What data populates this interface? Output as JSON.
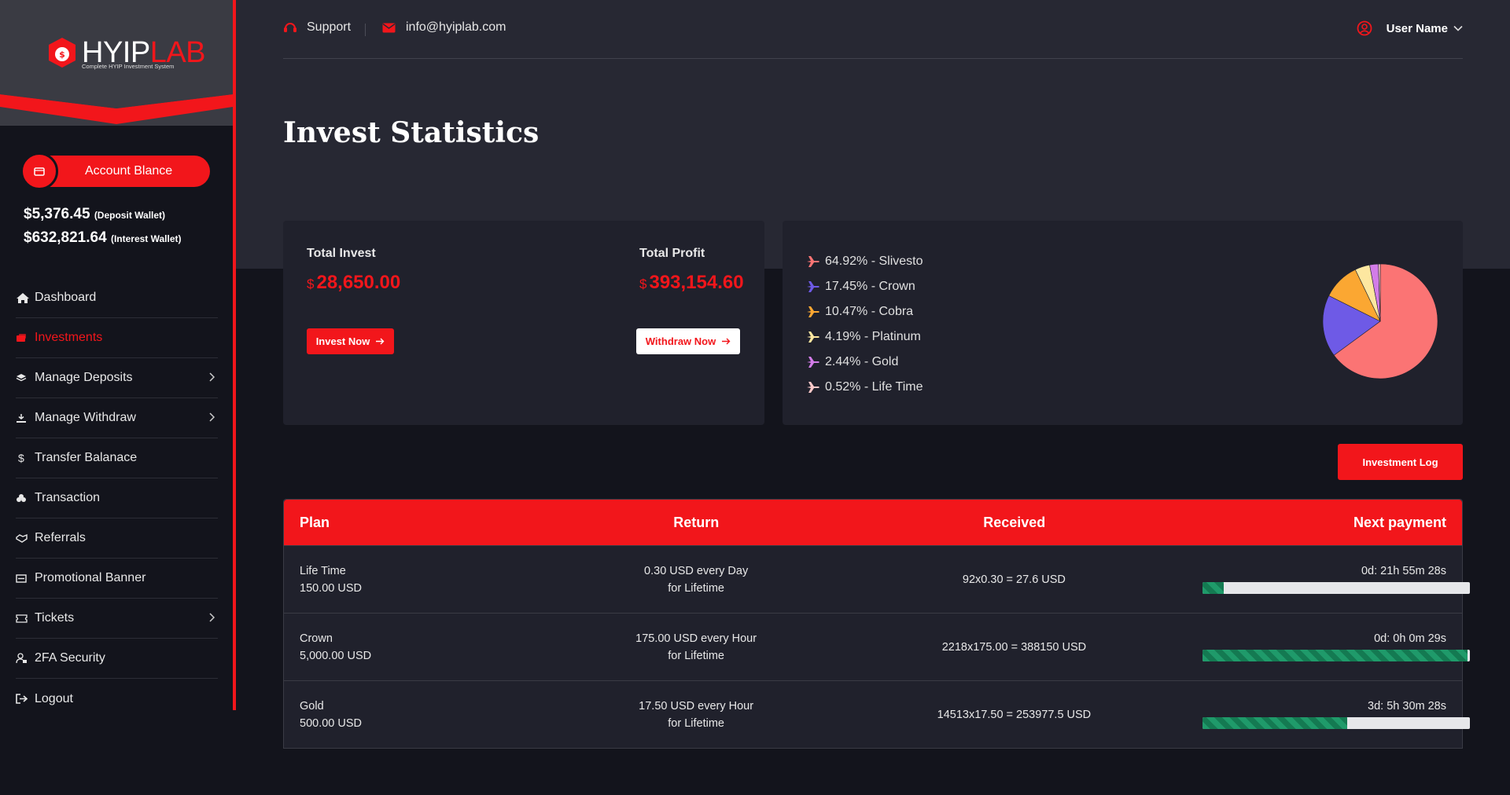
{
  "brand": {
    "name_a": "HYIP",
    "name_b": "LAB",
    "tagline": "Complete HYIP Investment System"
  },
  "colors": {
    "accent": "#f2161b",
    "bg": "#13141c",
    "card": "#20212c",
    "header_bg": "#272833"
  },
  "sidebar": {
    "balance_button": "Account Blance",
    "deposit_wallet": {
      "amount": "$5,376.45",
      "label": "(Deposit Wallet)"
    },
    "interest_wallet": {
      "amount": "$632,821.64",
      "label": "(Interest Wallet)"
    },
    "items": [
      {
        "label": "Dashboard",
        "icon": "home-icon"
      },
      {
        "label": "Investments",
        "icon": "investment-icon",
        "active": true
      },
      {
        "label": "Manage Deposits",
        "icon": "layers-icon",
        "submenu": true
      },
      {
        "label": "Manage Withdraw",
        "icon": "withdraw-icon",
        "submenu": true
      },
      {
        "label": "Transfer Balanace",
        "icon": "dollar-icon"
      },
      {
        "label": "Transaction",
        "icon": "coins-icon"
      },
      {
        "label": "Referrals",
        "icon": "handshake-icon"
      },
      {
        "label": "Promotional Banner",
        "icon": "banner-icon"
      },
      {
        "label": "Tickets",
        "icon": "ticket-icon",
        "submenu": true
      },
      {
        "label": "2FA Security",
        "icon": "user-lock-icon"
      },
      {
        "label": "Logout",
        "icon": "logout-icon"
      }
    ]
  },
  "topbar": {
    "support": "Support",
    "email": "info@hyiplab.com",
    "user": "User Name"
  },
  "page_title": "Invest Statistics",
  "summary": {
    "total_invest_label": "Total Invest",
    "total_invest_currency": "$",
    "total_invest_value": "28,650.00",
    "total_profit_label": "Total Profit",
    "total_profit_currency": "$",
    "total_profit_value": "393,154.60",
    "invest_button": "Invest Now",
    "withdraw_button": "Withdraw Now"
  },
  "chart_data": {
    "type": "pie",
    "slices": [
      {
        "label": "64.92% - Slivesto",
        "name": "Slivesto",
        "value": 64.92,
        "color": "#fb7474"
      },
      {
        "label": "17.45% - Crown",
        "name": "Crown",
        "value": 17.45,
        "color": "#6e5ae6"
      },
      {
        "label": "10.47% - Cobra",
        "name": "Cobra",
        "value": 10.47,
        "color": "#fba732"
      },
      {
        "label": "4.19% - Platinum",
        "name": "Platinum",
        "value": 4.19,
        "color": "#fde7a0"
      },
      {
        "label": "2.44% - Gold",
        "name": "Gold",
        "value": 2.44,
        "color": "#d27ce8"
      },
      {
        "label": "0.52% - Life Time",
        "name": "Life Time",
        "value": 0.52,
        "color": "#fbc9c9"
      }
    ]
  },
  "investment_log_button": "Investment Log",
  "table": {
    "headers": [
      "Plan",
      "Return",
      "Received",
      "Next payment"
    ],
    "rows": [
      {
        "plan": "Life Time",
        "amount": "150.00 USD",
        "return": "0.30 USD every Day",
        "return_term": "for Lifetime",
        "received": "92x0.30 = 27.6 USD",
        "next": "0d: 21h 55m 28s",
        "progress": 0.08
      },
      {
        "plan": "Crown",
        "amount": "5,000.00 USD",
        "return": "175.00 USD every Hour",
        "return_term": "for Lifetime",
        "received": "2218x175.00 = 388150 USD",
        "next": "0d: 0h 0m 29s",
        "progress": 0.99
      },
      {
        "plan": "Gold",
        "amount": "500.00 USD",
        "return": "17.50 USD every Hour",
        "return_term": "for Lifetime",
        "received": "14513x17.50 = 253977.5 USD",
        "next": "3d: 5h 30m 28s",
        "progress": 0.54
      }
    ]
  }
}
